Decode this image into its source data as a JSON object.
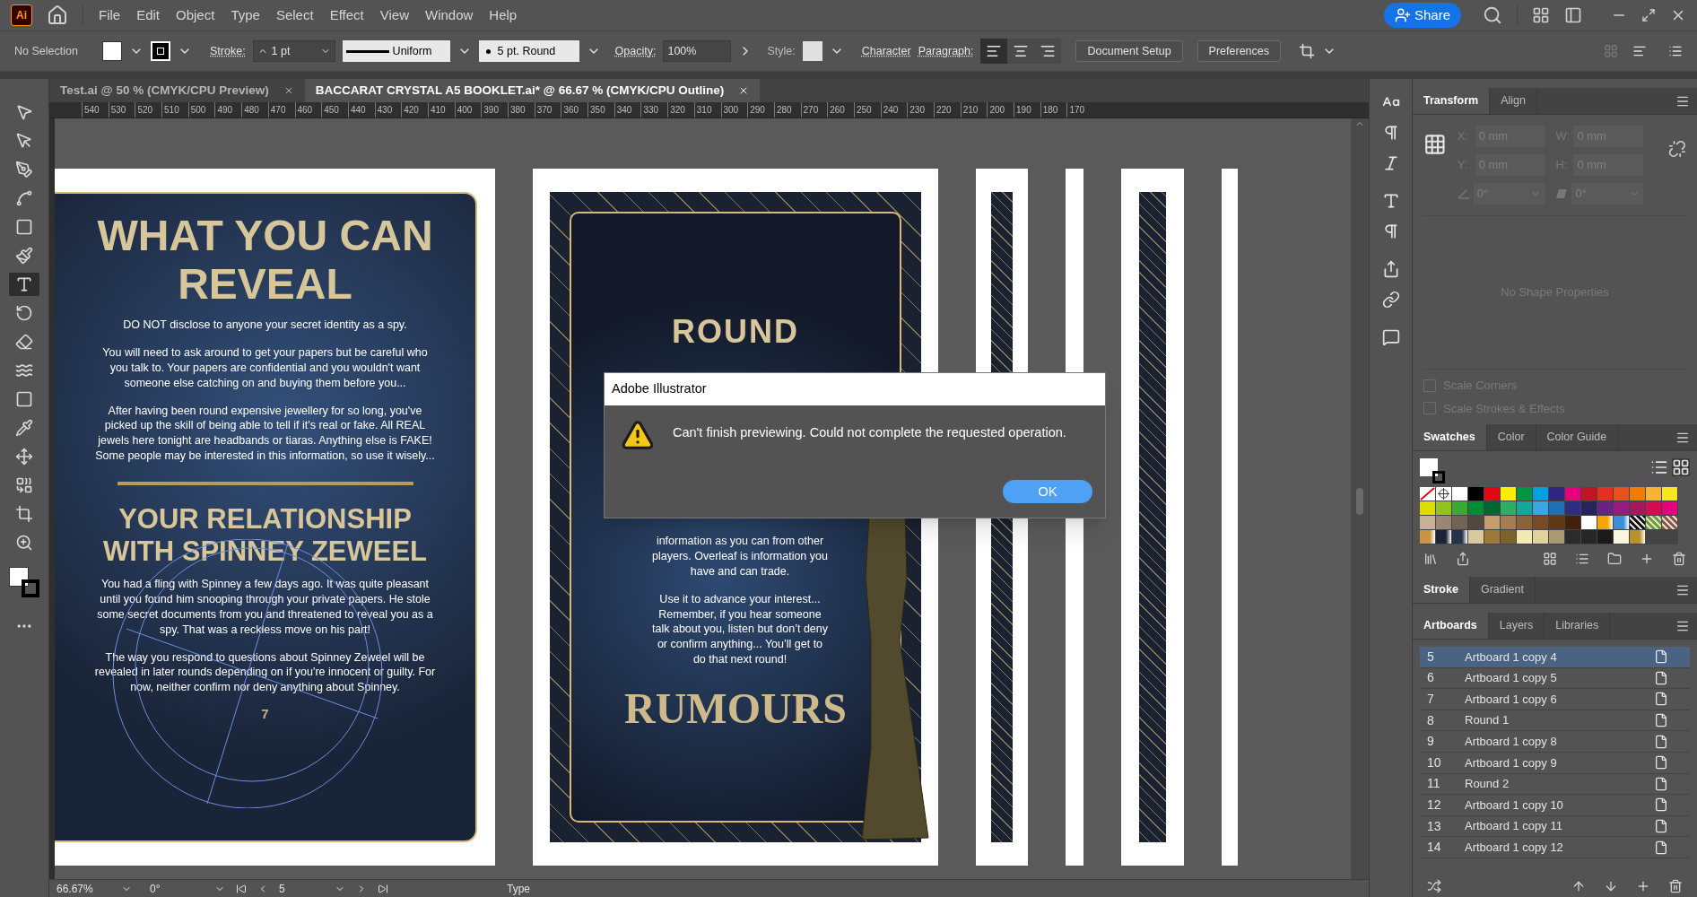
{
  "app": {
    "logo": "Ai",
    "menu": [
      "File",
      "Edit",
      "Object",
      "Type",
      "Select",
      "Effect",
      "View",
      "Window",
      "Help"
    ],
    "share": "Share"
  },
  "control_bar": {
    "selection": "No Selection",
    "stroke_label": "Stroke:",
    "stroke_weight": "1 pt",
    "profile": "Uniform",
    "brush": "5 pt. Round",
    "opacity_label": "Opacity:",
    "opacity": "100%",
    "style_label": "Style:",
    "character": "Character",
    "paragraph": "Paragraph:",
    "align": [
      {
        "kind": "left",
        "selected": true
      },
      {
        "kind": "center",
        "selected": false
      },
      {
        "kind": "right",
        "selected": false
      }
    ],
    "buttons": [
      "Document Setup",
      "Preferences"
    ]
  },
  "tools": [
    {
      "kind": "selection",
      "selected": false
    },
    {
      "kind": "direct-selection",
      "selected": false
    },
    {
      "kind": "pen",
      "selected": false
    },
    {
      "kind": "curvature",
      "selected": false
    },
    {
      "kind": "rectangle",
      "selected": false
    },
    {
      "kind": "paintbrush",
      "selected": false
    },
    {
      "kind": "type",
      "selected": true
    },
    {
      "kind": "rotate",
      "selected": false
    },
    {
      "kind": "eraser",
      "selected": false
    },
    {
      "kind": "warp",
      "selected": false
    },
    {
      "kind": "gradient",
      "selected": false
    },
    {
      "kind": "eyedropper",
      "selected": false
    },
    {
      "kind": "puppet",
      "selected": false
    },
    {
      "kind": "shape-builder",
      "selected": false
    },
    {
      "kind": "artboard",
      "selected": false
    },
    {
      "kind": "zoom",
      "selected": false
    }
  ],
  "document_tabs": [
    {
      "label": "Test.ai @ 50 % (CMYK/CPU Preview)",
      "selected": false
    },
    {
      "label": "BACCARAT CRYSTAL A5 BOOKLET.ai* @ 66.67 % (CMYK/CPU Outline)",
      "selected": true
    }
  ],
  "ruler": [
    "540",
    "530",
    "520",
    "510",
    "500",
    "490",
    "480",
    "470",
    "460",
    "450",
    "440",
    "430",
    "420",
    "410",
    "400",
    "390",
    "380",
    "370",
    "360",
    "350",
    "340",
    "330",
    "320",
    "310",
    "300",
    "290",
    "280",
    "270",
    "260",
    "250",
    "240",
    "230",
    "220",
    "210",
    "200",
    "190",
    "180",
    "170"
  ],
  "artboard_left": {
    "title": [
      "WHAT YOU CAN",
      "REVEAL"
    ],
    "paragraphs": [
      [
        "DO NOT disclose to anyone your secret identity as a spy."
      ],
      [
        "You will need to ask around to get your papers but be careful who you talk to. Your papers are confidential and you wouldn't want someone else catching on and buying them before you..."
      ],
      [
        "After having been round expensive jewellery for so long, you've picked up the skill of being able to tell if it's real or fake. All REAL jewels here tonight are headbands or tiaras. Anything else is FAKE!",
        "Some people may be interested in this information, so use it wisely..."
      ]
    ],
    "title_2": [
      "YOUR RELATIONSHIP",
      "WITH SPINNEY ZEWEEL"
    ],
    "paragraphs_2": [
      [
        "You had a fling with Spinney a few days ago. It was quite pleasant until you found him snooping through your private papers. He stole some secret documents from you and threatened to reveal you as a spy. That was a reckless move on his part!"
      ],
      [
        "The way you respond to questions about Spinney Zeweel will be revealed in later rounds depending on if you're innocent or guilty. For now, neither confirm nor deny anything about Spinney."
      ]
    ],
    "page_number": "7"
  },
  "artboard_middle": {
    "title": "ROUND",
    "paragraphs": [
      [
        "information as you can from other players. Overleaf is information you have and can trade."
      ],
      [
        "Use it to advance your interest... Remember, if you hear someone talk about you, listen but don’t deny or confirm anything... You’ll get to do that next round!"
      ]
    ],
    "heading": "RUMOURS"
  },
  "dialog": {
    "title": "Adobe Illustrator",
    "message": "Can't finish previewing. Could not complete the requested operation.",
    "button": "OK"
  },
  "status_bar": {
    "zoom": "66.67%",
    "rotation": "0°",
    "artboard": "5",
    "tool": "Type"
  },
  "transform_panel": {
    "tabs": [
      {
        "label": "Transform",
        "selected": true
      },
      {
        "label": "Align",
        "selected": false
      }
    ],
    "fields": [
      {
        "label": "X:",
        "value": "0 mm"
      },
      {
        "label": "W:",
        "value": "0 mm"
      },
      {
        "label": "Y:",
        "value": "0 mm"
      },
      {
        "label": "H:",
        "value": "0 mm"
      }
    ],
    "rotate": "0°",
    "shear": "0°",
    "empty_message": "No Shape Properties",
    "options": [
      {
        "label": "Scale Corners",
        "checked": false
      },
      {
        "label": "Scale Strokes & Effects",
        "checked": false
      }
    ]
  },
  "swatches_panel": {
    "tabs": [
      {
        "label": "Swatches",
        "selected": true
      },
      {
        "label": "Color",
        "selected": false
      },
      {
        "label": "Color Guide",
        "selected": false
      }
    ],
    "swatches": [
      {
        "kind": "none"
      },
      {
        "kind": "registration"
      },
      {
        "kind": "solid",
        "color": "#ffffff"
      },
      {
        "kind": "solid",
        "color": "#000000"
      },
      {
        "kind": "solid",
        "color": "#e30613"
      },
      {
        "kind": "solid",
        "color": "#ffed00"
      },
      {
        "kind": "solid",
        "color": "#009640"
      },
      {
        "kind": "solid",
        "color": "#009fe3"
      },
      {
        "kind": "solid",
        "color": "#312783"
      },
      {
        "kind": "solid",
        "color": "#e6007e"
      },
      {
        "kind": "solid",
        "color": "#be1622"
      },
      {
        "kind": "solid",
        "color": "#e52f20"
      },
      {
        "kind": "solid",
        "color": "#e8511d"
      },
      {
        "kind": "solid",
        "color": "#ef7d00"
      },
      {
        "kind": "solid",
        "color": "#f9b233"
      },
      {
        "kind": "solid",
        "color": "#f5e61f"
      },
      {
        "kind": "solid",
        "color": "#dedc00"
      },
      {
        "kind": "solid",
        "color": "#95c11f"
      },
      {
        "kind": "solid",
        "color": "#3aaa35"
      },
      {
        "kind": "solid",
        "color": "#008d36"
      },
      {
        "kind": "solid",
        "color": "#006633"
      },
      {
        "kind": "solid",
        "color": "#2fac66"
      },
      {
        "kind": "solid",
        "color": "#13a89e"
      },
      {
        "kind": "solid",
        "color": "#36a9e1"
      },
      {
        "kind": "solid",
        "color": "#1d71b8"
      },
      {
        "kind": "solid",
        "color": "#2d2e83"
      },
      {
        "kind": "solid",
        "color": "#29235c"
      },
      {
        "kind": "solid",
        "color": "#662483"
      },
      {
        "kind": "solid",
        "color": "#951b81"
      },
      {
        "kind": "solid",
        "color": "#a3195b"
      },
      {
        "kind": "solid",
        "color": "#d60b52"
      },
      {
        "kind": "solid",
        "color": "#e6007e"
      },
      {
        "kind": "solid",
        "color": "#c7b299"
      },
      {
        "kind": "solid",
        "color": "#998675"
      },
      {
        "kind": "solid",
        "color": "#736357"
      },
      {
        "kind": "solid",
        "color": "#534741"
      },
      {
        "kind": "solid",
        "color": "#c69c6d"
      },
      {
        "kind": "solid",
        "color": "#a67c52"
      },
      {
        "kind": "solid",
        "color": "#8c6239"
      },
      {
        "kind": "solid",
        "color": "#754c24"
      },
      {
        "kind": "solid",
        "color": "#603813"
      },
      {
        "kind": "solid",
        "color": "#42210b"
      },
      {
        "kind": "gradient",
        "color": "#ffffff"
      },
      {
        "kind": "gradient",
        "color": "#f7a600"
      },
      {
        "kind": "gradient",
        "color": "#3a8fd8"
      },
      {
        "kind": "pattern",
        "color": "#111111"
      },
      {
        "kind": "pattern",
        "color": "#6aa02c"
      },
      {
        "kind": "pattern",
        "color": "#8b5a3c"
      },
      {
        "kind": "gradient",
        "color": "#c8963e"
      },
      {
        "kind": "gradient",
        "color": "#1c2438"
      },
      {
        "kind": "gradient",
        "color": "#26324a"
      },
      {
        "kind": "solid",
        "color": "#d9c9a0"
      },
      {
        "kind": "solid",
        "color": "#9c7a37"
      },
      {
        "kind": "solid",
        "color": "#7a6428"
      },
      {
        "kind": "solid",
        "color": "#f2e9b5"
      },
      {
        "kind": "solid",
        "color": "#e0d49c"
      },
      {
        "kind": "solid",
        "color": "#a89a72"
      },
      {
        "kind": "solid",
        "color": "#2b2b2b"
      },
      {
        "kind": "solid",
        "color": "#262626"
      },
      {
        "kind": "solid",
        "color": "#1a1a1a"
      },
      {
        "kind": "solid",
        "color": "#f8f5e0"
      },
      {
        "kind": "gradient",
        "color": "#b8902f"
      }
    ]
  },
  "stroke_panel": {
    "tabs": [
      {
        "label": "Stroke",
        "selected": true
      },
      {
        "label": "Gradient",
        "selected": false
      }
    ]
  },
  "artboards_panel": {
    "tabs": [
      {
        "label": "Artboards",
        "selected": true
      },
      {
        "label": "Layers",
        "selected": false
      },
      {
        "label": "Libraries",
        "selected": false
      }
    ],
    "rows": [
      {
        "number": "5",
        "name": "Artboard 1 copy 4",
        "selected": true
      },
      {
        "number": "6",
        "name": "Artboard 1 copy 5",
        "selected": false
      },
      {
        "number": "7",
        "name": "Artboard 1 copy 6",
        "selected": false
      },
      {
        "number": "8",
        "name": "Round 1",
        "selected": false
      },
      {
        "number": "9",
        "name": "Artboard 1 copy 8",
        "selected": false
      },
      {
        "number": "10",
        "name": "Artboard 1 copy 9",
        "selected": false
      },
      {
        "number": "11",
        "name": "Round 2",
        "selected": false
      },
      {
        "number": "12",
        "name": "Artboard 1 copy 10",
        "selected": false
      },
      {
        "number": "13",
        "name": "Artboard 1 copy 11",
        "selected": false
      },
      {
        "number": "14",
        "name": "Artboard 1 copy 12",
        "selected": false
      }
    ]
  }
}
